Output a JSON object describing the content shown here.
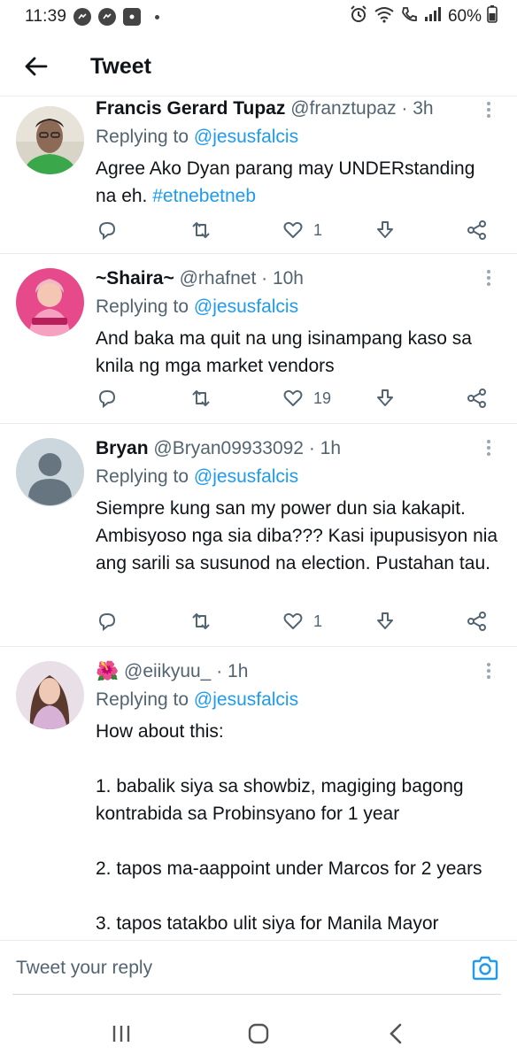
{
  "status_bar": {
    "time": "11:39",
    "battery": "60%"
  },
  "header": {
    "title": "Tweet"
  },
  "tweets": [
    {
      "name": "Francis Gerard Tupaz",
      "handle": "@franztupaz",
      "time": "· 3h",
      "replying_prefix": "Replying to ",
      "replying_to": "@jesusfalcis",
      "text": "Agree Ako Dyan parang may UNDERstanding na eh. ",
      "hashtag": "#etnebetneb",
      "replies": "",
      "retweets": "",
      "likes": "1"
    },
    {
      "name": "~Shaira~",
      "handle": "@rhafnet",
      "time": "· 10h",
      "replying_prefix": "Replying to ",
      "replying_to": "@jesusfalcis",
      "text": "And baka ma quit na ung isinampang kaso sa knila ng mga market vendors",
      "replies": "",
      "retweets": "",
      "likes": "19"
    },
    {
      "name": "Bryan",
      "handle": "@Bryan09933092",
      "time": "· 1h",
      "replying_prefix": "Replying to ",
      "replying_to": "@jesusfalcis",
      "text": "Siempre kung san my power dun sia kakapit. Ambisyoso nga sia diba??? Kasi ipupusisyon nia ang sarili sa susunod na election. Pustahan tau.",
      "replies": "",
      "retweets": "",
      "likes": "1"
    },
    {
      "name": "🌺",
      "handle": "@eiikyuu_",
      "time": "· 1h",
      "replying_prefix": "Replying to ",
      "replying_to": "@jesusfalcis",
      "text": "How about this:\n\n1. babalik siya sa showbiz, magiging bagong kontrabida sa Probinsyano for 1 year\n\n2. tapos ma-aappoint under Marcos for 2 years\n\n3. tapos tatakbo ulit siya for Manila Mayor"
    }
  ],
  "reply_bar": {
    "placeholder": "Tweet your reply"
  },
  "icons": {
    "reply": "reply-icon",
    "retweet": "retweet-icon",
    "like": "heart-icon",
    "share": "share-icon",
    "bookmark": "download-icon"
  },
  "colors": {
    "accent": "#1d9bf0",
    "text": "#0f1419",
    "secondary": "#536471"
  }
}
